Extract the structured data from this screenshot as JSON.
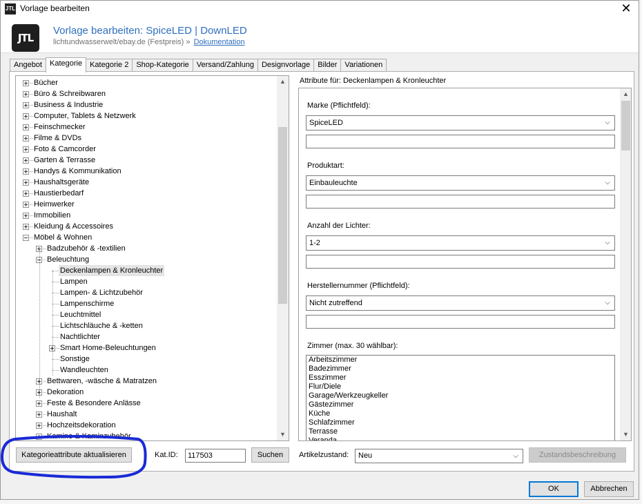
{
  "window": {
    "title": "Vorlage bearbeiten",
    "logo_text": "JTL",
    "close_glyph": "✕"
  },
  "header": {
    "logo_text": "JTL",
    "title": "Vorlage bearbeiten: SpiceLED | DownLED",
    "subtitle": "lichtundwasserwelt/ebay.de (Festpreis)",
    "separator": "»",
    "doc_link": "Dokumentation"
  },
  "tabs": [
    {
      "label": "Angebot"
    },
    {
      "label": "Kategorie"
    },
    {
      "label": "Kategorie 2"
    },
    {
      "label": "Shop-Kategorie"
    },
    {
      "label": "Versand/Zahlung"
    },
    {
      "label": "Designvorlage"
    },
    {
      "label": "Bilder"
    },
    {
      "label": "Variationen"
    }
  ],
  "tree": {
    "nodes": [
      {
        "label": "Bücher",
        "level": 0,
        "expander": "plus"
      },
      {
        "label": "Büro & Schreibwaren",
        "level": 0,
        "expander": "plus"
      },
      {
        "label": "Business & Industrie",
        "level": 0,
        "expander": "plus"
      },
      {
        "label": "Computer, Tablets & Netzwerk",
        "level": 0,
        "expander": "plus"
      },
      {
        "label": "Feinschmecker",
        "level": 0,
        "expander": "plus"
      },
      {
        "label": "Filme & DVDs",
        "level": 0,
        "expander": "plus"
      },
      {
        "label": "Foto & Camcorder",
        "level": 0,
        "expander": "plus"
      },
      {
        "label": "Garten & Terrasse",
        "level": 0,
        "expander": "plus"
      },
      {
        "label": "Handys & Kommunikation",
        "level": 0,
        "expander": "plus"
      },
      {
        "label": "Haushaltsgeräte",
        "level": 0,
        "expander": "plus"
      },
      {
        "label": "Haustierbedarf",
        "level": 0,
        "expander": "plus"
      },
      {
        "label": "Heimwerker",
        "level": 0,
        "expander": "plus"
      },
      {
        "label": "Immobilien",
        "level": 0,
        "expander": "plus"
      },
      {
        "label": "Kleidung & Accessoires",
        "level": 0,
        "expander": "plus"
      },
      {
        "label": "Möbel & Wohnen",
        "level": 0,
        "expander": "minus"
      },
      {
        "label": "Badzubehör & -textilien",
        "level": 1,
        "expander": "plus"
      },
      {
        "label": "Beleuchtung",
        "level": 1,
        "expander": "minus"
      },
      {
        "label": "Deckenlampen & Kronleuchter",
        "level": 2,
        "expander": "none",
        "selected": true
      },
      {
        "label": "Lampen",
        "level": 2,
        "expander": "none"
      },
      {
        "label": "Lampen- & Lichtzubehör",
        "level": 2,
        "expander": "none"
      },
      {
        "label": "Lampenschirme",
        "level": 2,
        "expander": "none"
      },
      {
        "label": "Leuchtmittel",
        "level": 2,
        "expander": "none"
      },
      {
        "label": "Lichtschläuche & -ketten",
        "level": 2,
        "expander": "none"
      },
      {
        "label": "Nachtlichter",
        "level": 2,
        "expander": "none"
      },
      {
        "label": "Smart Home-Beleuchtungen",
        "level": 2,
        "expander": "plus"
      },
      {
        "label": "Sonstige",
        "level": 2,
        "expander": "none"
      },
      {
        "label": "Wandleuchten",
        "level": 2,
        "expander": "none"
      },
      {
        "label": "Bettwaren, -wäsche & Matratzen",
        "level": 1,
        "expander": "plus"
      },
      {
        "label": "Dekoration",
        "level": 1,
        "expander": "plus"
      },
      {
        "label": "Feste & Besondere Anlässe",
        "level": 1,
        "expander": "plus"
      },
      {
        "label": "Haushalt",
        "level": 1,
        "expander": "plus"
      },
      {
        "label": "Hochzeitsdekoration",
        "level": 1,
        "expander": "plus"
      },
      {
        "label": "Kamine & Kaminzubehör",
        "level": 1,
        "expander": "plus"
      }
    ]
  },
  "attributes": {
    "title": "Attribute für: Deckenlampen & Kronleuchter",
    "fields": [
      {
        "label": "Marke (Pflichtfeld):",
        "value": "SpiceLED"
      },
      {
        "label": "Produktart:",
        "value": "Einbauleuchte"
      },
      {
        "label": "Anzahl der Lichter:",
        "value": "1-2"
      },
      {
        "label": "Herstellernummer (Pflichtfeld):",
        "value": "Nicht zutreffend"
      }
    ],
    "rooms_label": "Zimmer (max. 30 wählbar):",
    "rooms": [
      "Arbeitszimmer",
      "Badezimmer",
      "Esszimmer",
      "Flur/Diele",
      "Garage/Werkzeugkeller",
      "Gästezimmer",
      "Küche",
      "Schlafzimmer",
      "Terrasse",
      "Veranda"
    ]
  },
  "footer": {
    "update_button": "Kategorieattribute aktualisieren",
    "katid_label": "Kat.ID:",
    "katid_value": "117503",
    "search_button": "Suchen",
    "condition_label": "Artikelzustand:",
    "condition_value": "Neu",
    "condition_desc_button": "Zustandsbeschreibung",
    "ok_button": "OK",
    "cancel_button": "Abbrechen"
  },
  "colors": {
    "accent": "#2f6fbf",
    "annotation": "#1a2ad6"
  }
}
